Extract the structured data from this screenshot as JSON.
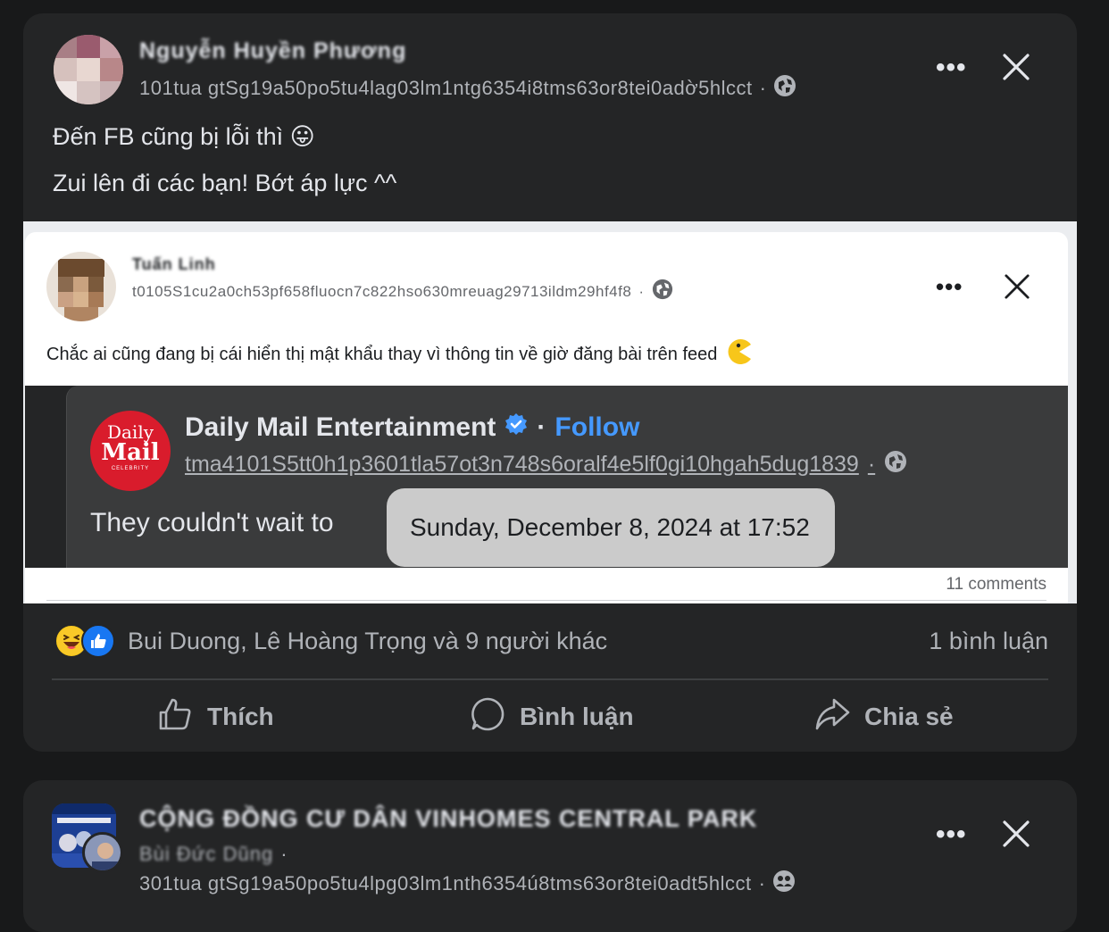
{
  "post1": {
    "author_name": "Nguyễn Huyền Phương",
    "meta_code": "101tua gtSg19a50po5tu4lag03lm1ntg6354i8tms63or8tei0adờ5hlcct",
    "audience_icon": "globe-icon",
    "more_icon": "more-options-icon",
    "close_icon": "close-icon",
    "text_line1": "Đến FB cũng bị lỗi thì",
    "text_line1_emoji": "😛",
    "text_line2": "Zui lên đi các bạn! Bớt áp lực ^^",
    "shared_screenshot": {
      "author_name": "Tuấn Linh",
      "meta_code": "t0105S1cu2a0ch53pf658fluocn7c822hso630mreuag29713ildm29hf4f8",
      "text": "Chắc ai cũng đang bị cái hiển thị mật khẩu thay vì thông tin về giờ đăng bài trên feed",
      "text_emoji": "pacman-emoji",
      "embedded_post": {
        "logo_line1": "Daily",
        "logo_line2": "Mail",
        "logo_line3": "CELEBRITY",
        "page_name": "Daily Mail Entertainment",
        "verified_icon": "verified-badge-icon",
        "separator": "·",
        "follow_label": "Follow",
        "link_code": "tma4101S5tt0h1p3601tla57ot3n748s6oralf4e5lf0gi10hgah5dug1839",
        "text": "They couldn't wait to",
        "tooltip": "Sunday, December 8, 2024 at 17:52"
      },
      "comments": "11 comments"
    },
    "reactions": {
      "icons": [
        "haha-reaction-icon",
        "like-reaction-icon"
      ],
      "names": "Bui Duong, Lê Hoàng Trọng và 9 người khác",
      "comment_count": "1 bình luận"
    },
    "actions": {
      "like_label": "Thích",
      "comment_label": "Bình luận",
      "share_label": "Chia sẻ"
    }
  },
  "post2": {
    "group_name": "CỘNG ĐỒNG CƯ DÂN VINHOMES CENTRAL PARK",
    "author_name": "Bùi Đức Dũng",
    "meta_code": "301tua gtSg19a50po5tu4lpg03lm1nth6354ú8tms63or8tei0adt5hlcct",
    "audience_icon": "group-members-icon"
  },
  "colors": {
    "page_bg": "#18191a",
    "card_bg": "#242526",
    "primary_text": "#e4e6eb",
    "secondary_text": "#b0b3b8",
    "link_blue": "#4599ff",
    "daily_mail_red": "#d91c2c"
  }
}
